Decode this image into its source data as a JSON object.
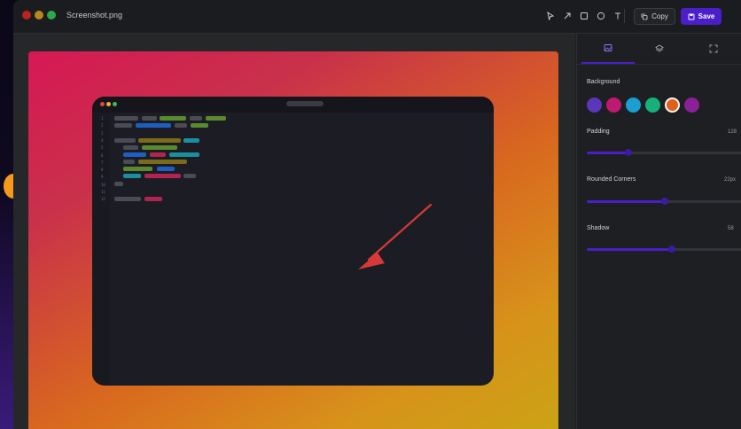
{
  "window": {
    "filename": "Screenshot.png"
  },
  "toolbar": {
    "tools": [
      {
        "name": "select-tool",
        "icon": "cursor-icon"
      },
      {
        "name": "arrow-tool",
        "icon": "arrow-icon"
      },
      {
        "name": "rectangle-tool",
        "icon": "square-icon"
      },
      {
        "name": "circle-tool",
        "icon": "circle-icon"
      },
      {
        "name": "text-tool",
        "icon": "text-icon"
      }
    ],
    "copy_label": "Copy",
    "save_label": "Save"
  },
  "panel": {
    "tabs": [
      "image-icon",
      "layers-icon",
      "expand-icon"
    ],
    "background": {
      "label": "Background",
      "swatches": [
        "#5a36b8",
        "#c01a70",
        "#1a9fd0",
        "#16b07a",
        "#e0621a",
        "#8a2196"
      ],
      "selected_index": 4
    },
    "padding": {
      "label": "Padding",
      "value": "128",
      "level": 0.27
    },
    "rounded": {
      "label": "Rounded Corners",
      "value": "22px",
      "level": 0.5
    },
    "shadow": {
      "label": "Shadow",
      "value": "58",
      "level": 0.55
    }
  },
  "colors": {
    "accent": "#4a1ec9",
    "arrow": "#d53a38"
  },
  "mock": {
    "line_numbers": [
      "1",
      "2",
      "3",
      "4",
      "5",
      "6",
      "7",
      "8",
      "9",
      "10",
      "11",
      "12"
    ]
  }
}
